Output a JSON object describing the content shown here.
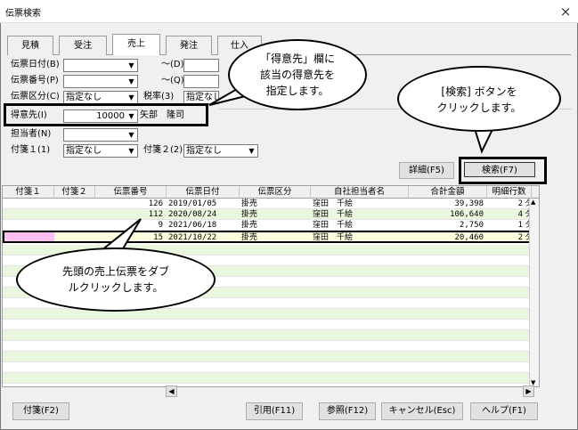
{
  "window": {
    "title": "伝票検索",
    "close_symbol": "×"
  },
  "tabs": [
    {
      "label": "見積",
      "active": false
    },
    {
      "label": "受注",
      "active": false
    },
    {
      "label": "売上",
      "active": true
    },
    {
      "label": "発注",
      "active": false
    },
    {
      "label": "仕入",
      "active": false
    }
  ],
  "form": {
    "date_label": "伝票日付(B)",
    "date_value": "",
    "date_to_label": "～(D)",
    "number_label": "伝票番号(P)",
    "number_value": "",
    "number_to_label": "～(Q)",
    "type_label": "伝票区分(C)",
    "type_value": "指定なし",
    "tax_label": "税率(3)",
    "tax_value": "指定なし",
    "customer_label": "得意先(I)",
    "customer_code": "10000",
    "customer_name": "矢部　隆司",
    "staff_label": "担当者(N)",
    "staff_value": "",
    "tag1_label": "付箋１(1)",
    "tag1_value": "指定なし",
    "tag2_label": "付箋２(2)",
    "tag2_value": "指定なし"
  },
  "buttons": {
    "detail": "詳細(F5)",
    "search": "検索(F7)",
    "tag": "付箋(F2)",
    "quote": "引用(F11)",
    "ref": "参照(F12)",
    "cancel": "キャンセル(Esc)",
    "help": "ヘルプ(F1)"
  },
  "table": {
    "headers": [
      "付箋１",
      "付箋２",
      "伝票番号",
      "伝票日付",
      "伝票区分",
      "自社担当者名",
      "合計金額",
      "明細行数"
    ],
    "rows": [
      {
        "number": "126",
        "date": "2019/01/05",
        "type": "掛売",
        "staff": "窪田　千絵",
        "total": "39,398",
        "lines": "2"
      },
      {
        "number": "112",
        "date": "2020/08/24",
        "type": "掛売",
        "staff": "窪田　千絵",
        "total": "106,640",
        "lines": "4"
      },
      {
        "number": "9",
        "date": "2021/06/18",
        "type": "掛売",
        "staff": "窪田　千絵",
        "total": "2,750",
        "lines": "1"
      },
      {
        "number": "15",
        "date": "2021/10/22",
        "type": "掛売",
        "staff": "窪田　千絵",
        "total": "20,460",
        "lines": "2"
      }
    ],
    "row_suffix": "タ",
    "selected_tag_color": "#ffc0f0"
  },
  "callouts": {
    "customer_line1": "「得意先」欄に",
    "customer_line2": "該当の得意先を",
    "customer_line3": "指定します。",
    "search_line1": "[検索] ボタンを",
    "search_line2": "クリックします。",
    "row_line1": "先頭の売上伝票をダブ",
    "row_line2": "ルクリックします。"
  },
  "icons": {
    "dropdown": "dropdown-arrow-icon",
    "close": "close-icon"
  }
}
